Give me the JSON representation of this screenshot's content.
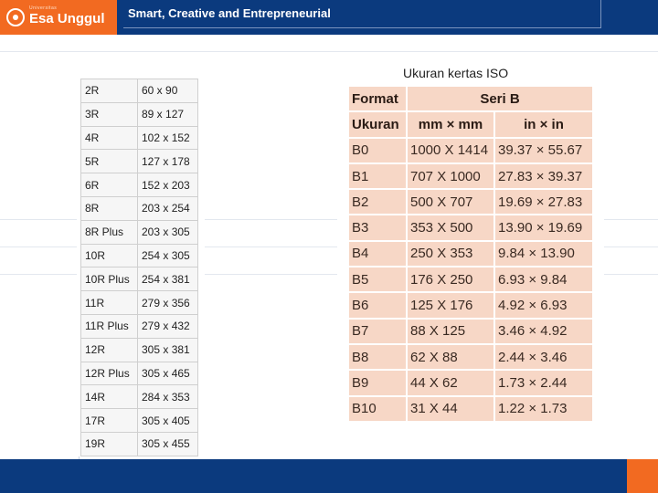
{
  "header": {
    "logo_small": "Universitas",
    "logo_text": "Esa Unggul",
    "tagline": "Smart, Creative and Entrepreneurial"
  },
  "left_table": {
    "rows": [
      [
        "2R",
        "60 x 90"
      ],
      [
        "3R",
        "89 x 127"
      ],
      [
        "4R",
        "102 x 152"
      ],
      [
        "5R",
        "127 x 178"
      ],
      [
        "6R",
        "152 x 203"
      ],
      [
        "8R",
        "203 x 254"
      ],
      [
        "8R Plus",
        "203 x 305"
      ],
      [
        "10R",
        "254 x 305"
      ],
      [
        "10R Plus",
        "254 x 381"
      ],
      [
        "11R",
        "279 x 356"
      ],
      [
        "11R Plus",
        "279 x 432"
      ],
      [
        "12R",
        "305 x 381"
      ],
      [
        "12R Plus",
        "305 x 465"
      ],
      [
        "14R",
        "284 x 353"
      ],
      [
        "17R",
        "305 x 405"
      ],
      [
        "19R",
        "305 x 455"
      ]
    ]
  },
  "right_table": {
    "title": "Ukuran kertas ISO",
    "header1": [
      "Format",
      "Seri B"
    ],
    "header2": [
      "Ukuran",
      "mm × mm",
      "in × in"
    ],
    "rows": [
      [
        "B0",
        "1000 X 1414",
        "39.37 × 55.67"
      ],
      [
        "B1",
        "707 X 1000",
        "27.83 × 39.37"
      ],
      [
        "B2",
        "500 X 707",
        "19.69 × 27.83"
      ],
      [
        "B3",
        "353 X 500",
        "13.90 × 19.69"
      ],
      [
        "B4",
        "250 X 353",
        "9.84 × 13.90"
      ],
      [
        "B5",
        "176 X 250",
        "6.93 × 9.84"
      ],
      [
        "B6",
        "125 X 176",
        "4.92 × 6.93"
      ],
      [
        "B7",
        "88 X 125",
        "3.46 × 4.92"
      ],
      [
        "B8",
        "62 X 88",
        "2.44 × 3.46"
      ],
      [
        "B9",
        "44 X 62",
        "1.73 × 2.44"
      ],
      [
        "B10",
        "31 X 44",
        "1.22 × 1.73"
      ]
    ]
  },
  "colors": {
    "brand_blue": "#0b3a7e",
    "brand_orange": "#f26a21",
    "table_cell": "#f7d7c6"
  }
}
